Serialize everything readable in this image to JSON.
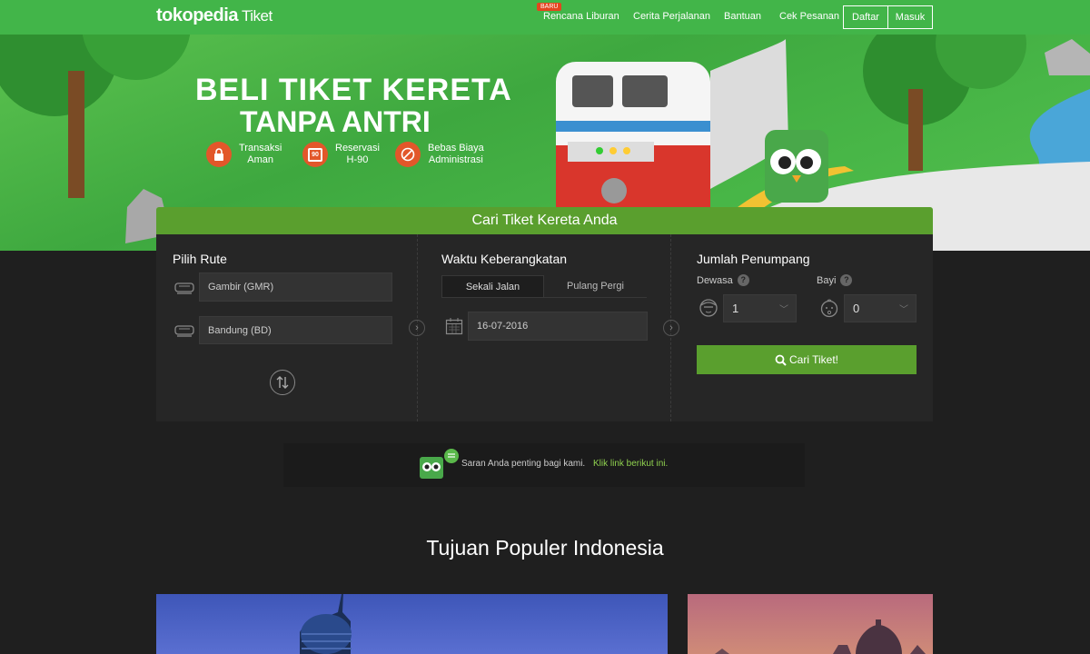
{
  "nav": {
    "brand": "tokopedia",
    "brand_sub": "Tiket",
    "badge": "BARU",
    "links": [
      "Rencana Liburan",
      "Cerita Perjalanan",
      "Bantuan",
      "Cek Pesanan"
    ],
    "register": "Daftar",
    "login": "Masuk"
  },
  "hero": {
    "title_line1": "BELI TIKET KERETA",
    "title_line2": "TANPA ANTRI",
    "features": [
      {
        "line1": "Transaksi",
        "line2": "Aman",
        "icon": "lock-icon"
      },
      {
        "line1": "Reservasi",
        "line2": "H-90",
        "icon": "calendar-90-icon"
      },
      {
        "line1": "Bebas Biaya",
        "line2": "Administrasi",
        "icon": "no-fee-icon"
      }
    ],
    "calendar_number": "90"
  },
  "search": {
    "heading": "Cari Tiket Kereta Anda",
    "route": {
      "title": "Pilih Rute",
      "origin": "Gambir (GMR)",
      "destination": "Bandung (BD)"
    },
    "departure": {
      "title": "Waktu Keberangkatan",
      "tabs": [
        "Sekali Jalan",
        "Pulang Pergi"
      ],
      "date": "16-07-2016"
    },
    "passengers": {
      "title": "Jumlah Penumpang",
      "adult_label": "Dewasa",
      "adult_value": "1",
      "infant_label": "Bayi",
      "infant_value": "0",
      "help": "?"
    },
    "button": "Cari Tiket!"
  },
  "feedback": {
    "text": "Saran Anda penting bagi kami.",
    "link": "Klik link berikut ini."
  },
  "popular": {
    "title": "Tujuan Populer Indonesia"
  },
  "colors": {
    "nav_green": "#42b549",
    "panel_green": "#5a9f2e",
    "feature_orange": "#e2572a",
    "link_green": "#8fd14f"
  }
}
